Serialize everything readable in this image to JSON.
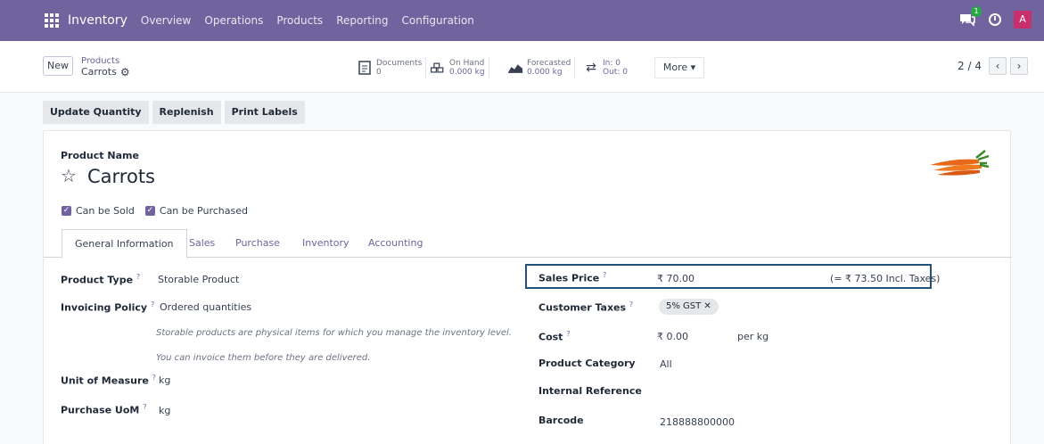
{
  "app": {
    "name": "Inventory",
    "menu": [
      "Overview",
      "Operations",
      "Products",
      "Reporting",
      "Configuration"
    ],
    "chat_badge": "1",
    "avatar_letter": "A",
    "accent_color": "#71639e"
  },
  "control": {
    "new_label": "New",
    "breadcrumb_parent": "Products",
    "breadcrumb_current": "Carrots",
    "stats": {
      "documents_label": "Documents",
      "documents_value": "0",
      "onhand_label": "On Hand",
      "onhand_value": "0.000 kg",
      "forecasted_label": "Forecasted",
      "forecasted_value": "0.000 kg",
      "in_label": "In: 0",
      "out_label": "Out: 0"
    },
    "more_label": "More ▾",
    "pager": "2 / 4"
  },
  "actions": [
    "Update Quantity",
    "Replenish",
    "Print Labels"
  ],
  "product": {
    "name_label": "Product Name",
    "name": "Carrots",
    "can_be_sold": "Can be Sold",
    "can_be_purchased": "Can be Purchased"
  },
  "tabs": [
    "General Information",
    "Sales",
    "Purchase",
    "Inventory",
    "Accounting"
  ],
  "left_fields": {
    "product_type_label": "Product Type",
    "product_type_value": "Storable Product",
    "invoicing_policy_label": "Invoicing Policy",
    "invoicing_policy_value": "Ordered quantities",
    "note1": "Storable products are physical items for which you manage the inventory level.",
    "note2": "You can invoice them before they are delivered.",
    "uom_label": "Unit of Measure",
    "uom_value": "kg",
    "purchase_uom_label": "Purchase UoM",
    "purchase_uom_value": "kg"
  },
  "right_fields": {
    "sales_price_label": "Sales Price",
    "sales_price_value": "₹ 70.00",
    "sales_price_incl": "(= ₹ 73.50 Incl. Taxes)",
    "customer_taxes_label": "Customer Taxes",
    "customer_taxes_tag": "5% GST ✕",
    "cost_label": "Cost",
    "cost_value": "₹ 0.00",
    "cost_unit": "per kg",
    "category_label": "Product Category",
    "category_value": "All",
    "internal_ref_label": "Internal Reference",
    "barcode_label": "Barcode",
    "barcode_value": "218888800000"
  },
  "help_mark": "?"
}
